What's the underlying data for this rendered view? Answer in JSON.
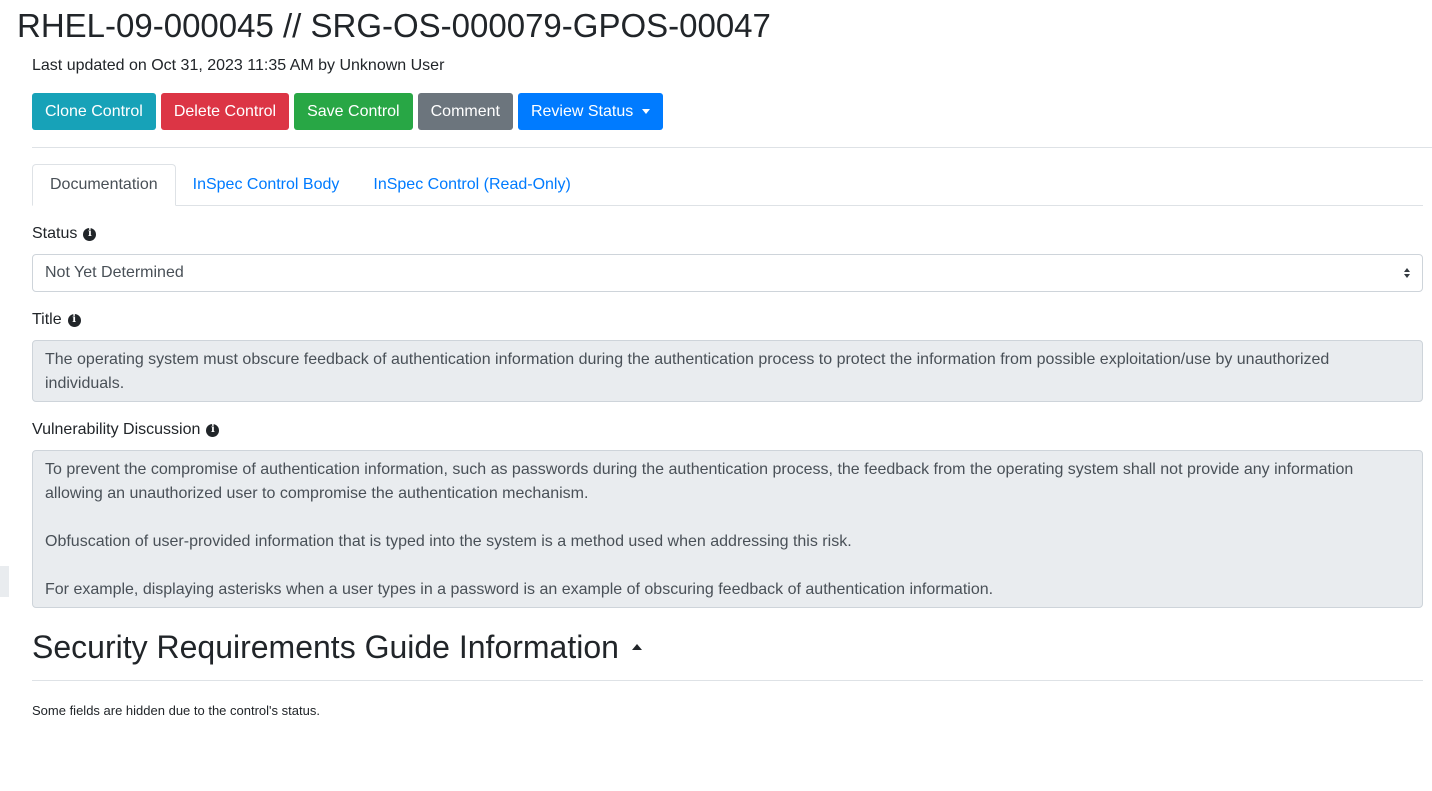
{
  "header": {
    "title": "RHEL-09-000045 // SRG-OS-000079-GPOS-00047",
    "last_updated": "Last updated on Oct 31, 2023 11:35 AM by Unknown User"
  },
  "toolbar": {
    "clone_label": "Clone Control",
    "delete_label": "Delete Control",
    "save_label": "Save Control",
    "comment_label": "Comment",
    "review_status_label": "Review Status"
  },
  "tabs": [
    {
      "label": "Documentation",
      "active": true
    },
    {
      "label": "InSpec Control Body",
      "active": false
    },
    {
      "label": "InSpec Control (Read-Only)",
      "active": false
    }
  ],
  "form": {
    "status": {
      "label": "Status",
      "selected": "Not Yet Determined"
    },
    "title": {
      "label": "Title",
      "value": "The operating system must obscure feedback of authentication information during the authentication process to protect the information from possible exploitation/use by unauthorized individuals."
    },
    "vuln_discussion": {
      "label": "Vulnerability Discussion",
      "paragraphs": [
        "To prevent the compromise of authentication information, such as passwords during the authentication process, the feedback from the operating system shall not provide any information allowing an unauthorized user to compromise the authentication mechanism.",
        "Obfuscation of user-provided information that is typed into the system is a method used when addressing this risk.",
        "For example, displaying asterisks when a user types in a password is an example of obscuring feedback of authentication information."
      ]
    }
  },
  "srg_section": {
    "heading": "Security Requirements Guide Information",
    "note": "Some fields are hidden due to the control's status."
  },
  "colors": {
    "clone": "#17a2b8",
    "delete": "#dc3545",
    "save": "#28a745",
    "comment": "#6c757d",
    "review": "#007bff",
    "link": "#007bff",
    "readonly_bg": "#e9ecef"
  },
  "icons": {
    "info": "info-circle-icon",
    "dropdown": "caret-down-icon",
    "collapse": "caret-up-icon",
    "select": "select-arrows-icon"
  }
}
